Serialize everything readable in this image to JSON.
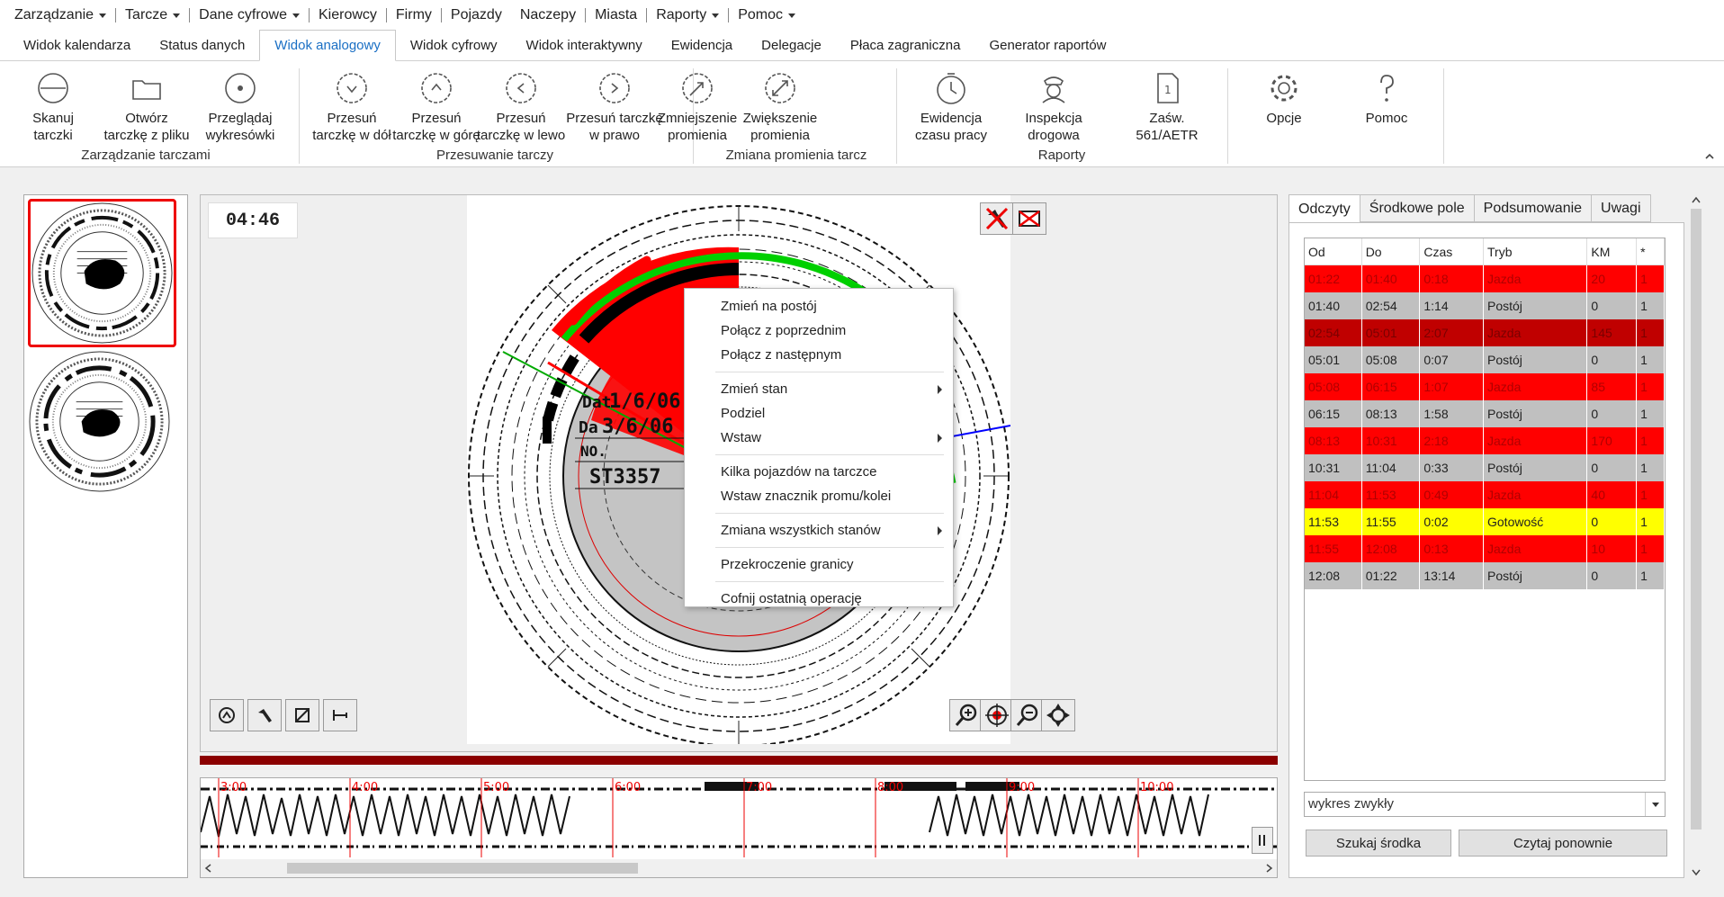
{
  "menu": [
    {
      "label": "Zarządzanie",
      "dropdown": true
    },
    {
      "label": "Tarcze",
      "dropdown": true
    },
    {
      "label": "Dane cyfrowe",
      "dropdown": true
    },
    {
      "label": "Kierowcy",
      "dropdown": false
    },
    {
      "label": "Firmy",
      "dropdown": false
    },
    {
      "label": "Pojazdy",
      "dropdown": false
    },
    {
      "label": "Naczepy",
      "dropdown": false
    },
    {
      "label": "Miasta",
      "dropdown": false
    },
    {
      "label": "Raporty",
      "dropdown": true
    },
    {
      "label": "Pomoc",
      "dropdown": true
    }
  ],
  "tabs": [
    "Widok kalendarza",
    "Status danych",
    "Widok analogowy",
    "Widok cyfrowy",
    "Widok interaktywny",
    "Ewidencja",
    "Delegacje",
    "Płaca zagraniczna",
    "Generator raportów"
  ],
  "active_tab": "Widok analogowy",
  "ribbon": {
    "buttons": [
      {
        "l1": "Skanuj",
        "l2": "tarczki",
        "icon": "scan-disc-icon"
      },
      {
        "l1": "Otwórz",
        "l2": "tarczkę z pliku",
        "icon": "open-folder-icon"
      },
      {
        "l1": "Przeglądaj",
        "l2": "wykresówki",
        "icon": "browse-disc-icon"
      },
      {
        "l1": "Przesuń",
        "l2": "tarczkę w dół",
        "icon": "move-down-icon"
      },
      {
        "l1": "Przesuń",
        "l2": "tarczkę w górę",
        "icon": "move-up-icon"
      },
      {
        "l1": "Przesuń",
        "l2": "tarczkę w lewo",
        "icon": "move-left-icon"
      },
      {
        "l1": "Przesuń tarczkę",
        "l2": "w prawo",
        "icon": "move-right-icon"
      },
      {
        "l1": "Zmniejszenie",
        "l2": "promienia",
        "icon": "shrink-radius-icon"
      },
      {
        "l1": "Zwiększenie",
        "l2": "promienia",
        "icon": "grow-radius-icon"
      },
      {
        "l1": "Ewidencja",
        "l2": "czasu pracy",
        "icon": "clock-icon"
      },
      {
        "l1": "Inspekcja",
        "l2": "drogowa",
        "icon": "officer-icon"
      },
      {
        "l1": "Zaśw.",
        "l2": "561/AETR",
        "icon": "document-icon"
      },
      {
        "l1": "Opcje",
        "l2": "",
        "icon": "gear-icon"
      },
      {
        "l1": "Pomoc",
        "l2": "",
        "icon": "question-icon"
      }
    ],
    "groups": [
      "Zarządzanie tarczami",
      "Przesuwanie tarczy",
      "Zmiana promienia tarcz",
      "Raporty"
    ]
  },
  "viewer": {
    "time": "04:46",
    "disc_text": {
      "date_label": "Dat",
      "date_value": "1/6/06",
      "date2_label": "Da",
      "date2_value": "3/6/06",
      "no_label": "NO.",
      "plate": "ST3357"
    },
    "strip_hours": [
      "3:00",
      "4:00",
      "5:00",
      "6:00",
      "7:00",
      "8:00",
      "9:00",
      "10:00"
    ]
  },
  "context_menu": [
    {
      "label": "Zmień na postój",
      "sub": false
    },
    {
      "label": "Połącz z poprzednim",
      "sub": false
    },
    {
      "label": "Połącz z następnym",
      "sub": false
    },
    {
      "sep": true
    },
    {
      "label": "Zmień stan",
      "sub": true
    },
    {
      "label": "Podziel",
      "sub": false
    },
    {
      "label": "Wstaw",
      "sub": true
    },
    {
      "sep": true
    },
    {
      "label": "Kilka pojazdów na tarczce",
      "sub": false
    },
    {
      "label": "Wstaw znacznik promu/kolei",
      "sub": false
    },
    {
      "sep": true
    },
    {
      "label": "Zmiana wszystkich stanów",
      "sub": true
    },
    {
      "sep": true
    },
    {
      "label": "Przekroczenie granicy",
      "sub": false
    },
    {
      "sep": true
    },
    {
      "label": "Cofnij ostatnią operację",
      "sub": false
    }
  ],
  "right_panel": {
    "tabs": [
      "Odczyty",
      "Środkowe pole",
      "Podsumowanie",
      "Uwagi"
    ],
    "columns": [
      "Od",
      "Do",
      "Czas",
      "Tryb",
      "KM",
      "*"
    ],
    "rows": [
      {
        "od": "01:22",
        "do": "01:40",
        "czas": "0:18",
        "tryb": "Jazda",
        "km": "20",
        "star": "1",
        "style": "red"
      },
      {
        "od": "01:40",
        "do": "02:54",
        "czas": "1:14",
        "tryb": "Postój",
        "km": "0",
        "star": "1",
        "style": "grey"
      },
      {
        "od": "02:54",
        "do": "05:01",
        "czas": "2:07",
        "tryb": "Jazda",
        "km": "145",
        "star": "1",
        "style": "dark"
      },
      {
        "od": "05:01",
        "do": "05:08",
        "czas": "0:07",
        "tryb": "Postój",
        "km": "0",
        "star": "1",
        "style": "grey"
      },
      {
        "od": "05:08",
        "do": "06:15",
        "czas": "1:07",
        "tryb": "Jazda",
        "km": "85",
        "star": "1",
        "style": "red"
      },
      {
        "od": "06:15",
        "do": "08:13",
        "czas": "1:58",
        "tryb": "Postój",
        "km": "0",
        "star": "1",
        "style": "grey"
      },
      {
        "od": "08:13",
        "do": "10:31",
        "czas": "2:18",
        "tryb": "Jazda",
        "km": "170",
        "star": "1",
        "style": "red"
      },
      {
        "od": "10:31",
        "do": "11:04",
        "czas": "0:33",
        "tryb": "Postój",
        "km": "0",
        "star": "1",
        "style": "grey"
      },
      {
        "od": "11:04",
        "do": "11:53",
        "czas": "0:49",
        "tryb": "Jazda",
        "km": "40",
        "star": "1",
        "style": "red"
      },
      {
        "od": "11:53",
        "do": "11:55",
        "czas": "0:02",
        "tryb": "Gotowość",
        "km": "0",
        "star": "1",
        "style": "yellow"
      },
      {
        "od": "11:55",
        "do": "12:08",
        "czas": "0:13",
        "tryb": "Jazda",
        "km": "10",
        "star": "1",
        "style": "red"
      },
      {
        "od": "12:08",
        "do": "01:22",
        "czas": "13:14",
        "tryb": "Postój",
        "km": "0",
        "star": "1",
        "style": "grey"
      }
    ],
    "chart_mode": "wykres zwykły",
    "btn_center": "Szukaj środka",
    "btn_reread": "Czytaj ponownie"
  }
}
